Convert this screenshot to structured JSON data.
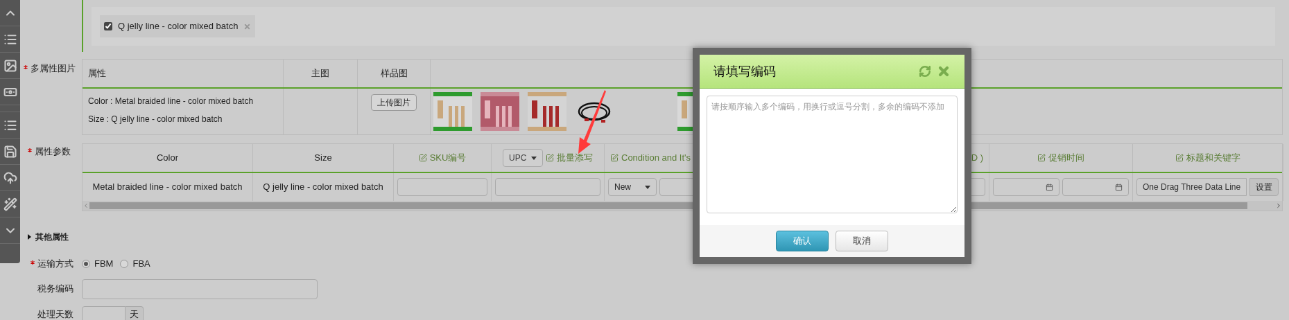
{
  "tag_chip": {
    "label": "Q jelly line - color mixed batch",
    "checked": true
  },
  "image_section": {
    "label": "多属性图片",
    "required": true,
    "columns": [
      "属性",
      "主图",
      "样品图"
    ],
    "row": {
      "attributes": [
        "Color : Metal braided line - color mixed batch",
        "Size : Q jelly line - color mixed batch"
      ],
      "upload_button": "上传图片",
      "images": [
        {
          "kind": "picture"
        },
        {
          "kind": "picture"
        },
        {
          "kind": "picture"
        },
        {
          "kind": "picture"
        },
        {
          "kind": "picture"
        }
      ]
    }
  },
  "params_section": {
    "label": "属性参数",
    "required": true,
    "columns": [
      {
        "kind": "plain",
        "label": "Color"
      },
      {
        "kind": "plain",
        "label": "Size"
      },
      {
        "kind": "edit",
        "label": "SKU编号"
      },
      {
        "kind": "select_edit",
        "select": "UPC",
        "label": "批量添写"
      },
      {
        "kind": "edit",
        "label": "Condition and It's"
      },
      {
        "kind": "fragment",
        "label": "D )"
      },
      {
        "kind": "edit",
        "label": "促销时间"
      },
      {
        "kind": "edit",
        "label": "标题和关键字"
      }
    ],
    "row": [
      {
        "kind": "text",
        "value": "Metal braided line - color mixed batch"
      },
      {
        "kind": "text",
        "value": "Q jelly line - color mixed batch"
      },
      {
        "kind": "input"
      },
      {
        "kind": "input"
      },
      {
        "kind": "select_input",
        "value": "New"
      },
      {
        "kind": "input_right"
      },
      {
        "kind": "dates"
      },
      {
        "kind": "input_button",
        "value": "One Drag Three Data Line",
        "button": "设置"
      }
    ]
  },
  "other_attributes": {
    "label": "其他属性",
    "expanded": false
  },
  "shipping": {
    "label": "运输方式",
    "required": true,
    "options": [
      {
        "label": "FBM",
        "selected": true
      },
      {
        "label": "FBA",
        "selected": false
      }
    ]
  },
  "tax_code": {
    "label": "税务编码"
  },
  "handling_days": {
    "label": "处理天数",
    "unit": "天"
  },
  "dialog": {
    "title": "请填写编码",
    "placeholder": "请按顺序输入多个编码，用换行或逗号分割，多余的编码不添加",
    "confirm": "确认",
    "cancel": "取消"
  }
}
